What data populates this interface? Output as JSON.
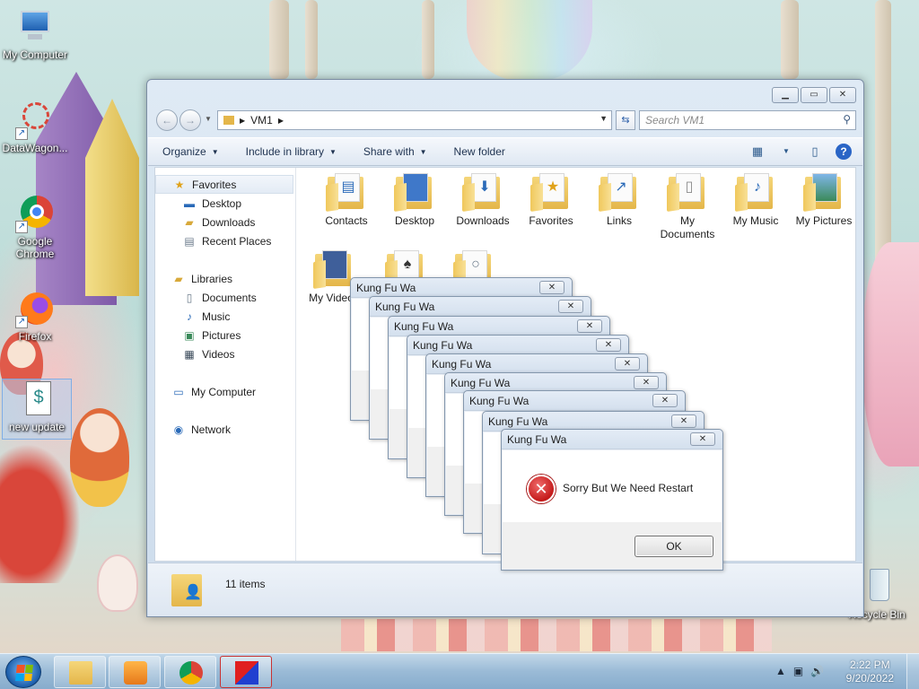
{
  "desktop": {
    "icons": [
      {
        "label": "My Computer"
      },
      {
        "label": "DataWagon..."
      },
      {
        "label": "Google Chrome"
      },
      {
        "label": "Firefox"
      },
      {
        "label": "new update"
      },
      {
        "label": "Recycle Bin"
      }
    ]
  },
  "explorer": {
    "breadcrumb": "VM1",
    "search_placeholder": "Search VM1",
    "toolbar": {
      "organize": "Organize",
      "include_in_library": "Include in library",
      "share_with": "Share with",
      "new_folder": "New folder"
    },
    "nav_pane": {
      "favorites": "Favorites",
      "desktop": "Desktop",
      "downloads": "Downloads",
      "recent_places": "Recent Places",
      "libraries": "Libraries",
      "documents": "Documents",
      "music": "Music",
      "pictures": "Pictures",
      "videos": "Videos",
      "my_computer": "My Computer",
      "network": "Network"
    },
    "files": [
      {
        "name": "Contacts"
      },
      {
        "name": "Desktop"
      },
      {
        "name": "Downloads"
      },
      {
        "name": "Favorites"
      },
      {
        "name": "Links"
      },
      {
        "name": "My Documents"
      },
      {
        "name": "My Music"
      },
      {
        "name": "My Pictures"
      },
      {
        "name": "My Videos"
      },
      {
        "name": ""
      },
      {
        "name": ""
      }
    ],
    "status": "11 items"
  },
  "dialog": {
    "title": "Kung Fu Wa",
    "message": "Sorry But We Need Restart",
    "ok_label": "OK",
    "close_glyph": "✕"
  },
  "taskbar": {
    "time": "2:22 PM",
    "date": "9/20/2022"
  },
  "colors": {
    "error_red": "#c41a1a",
    "folder_yellow": "#e4b64a",
    "taskbar_blue": "#96b9d7"
  }
}
